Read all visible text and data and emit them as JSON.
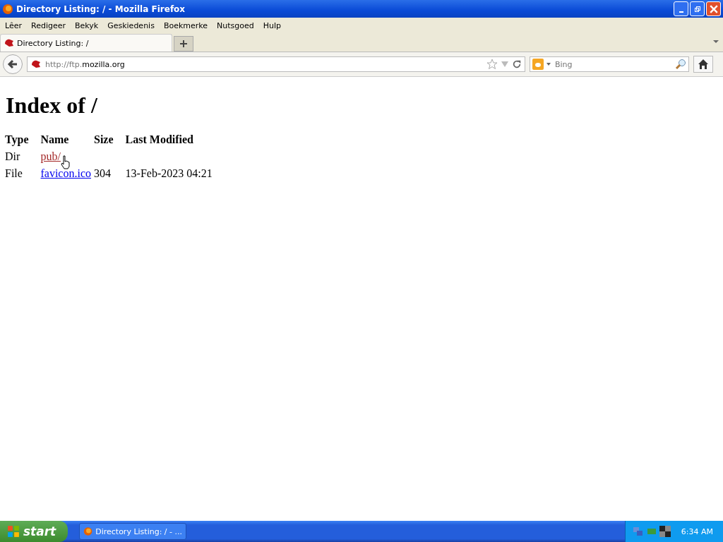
{
  "window": {
    "title": "Directory Listing: / - Mozilla Firefox"
  },
  "menu": [
    "Lêer",
    "Redigeer",
    "Bekyk",
    "Geskiedenis",
    "Boekmerke",
    "Nutsgoed",
    "Hulp"
  ],
  "tabs": [
    {
      "label": "Directory Listing: /",
      "selected": true
    }
  ],
  "address": {
    "value_prefix": "http://ftp.",
    "value_host": "mozilla.org"
  },
  "search": {
    "placeholder": "Bing"
  },
  "page": {
    "heading": "Index of /",
    "columns": [
      "Type",
      "Name",
      "Size",
      "Last Modified"
    ],
    "rows": [
      {
        "type": "Dir",
        "name": "pub/",
        "hovered": true
      },
      {
        "type": "File",
        "name": "favicon.ico",
        "size": "304",
        "modified": "13-Feb-2023 04:21",
        "hovered": false
      }
    ]
  },
  "taskbar": {
    "start": "start",
    "tasks": [
      {
        "label": "Directory Listing: / - ...",
        "selected": false
      }
    ],
    "clock": "6:34 AM"
  }
}
